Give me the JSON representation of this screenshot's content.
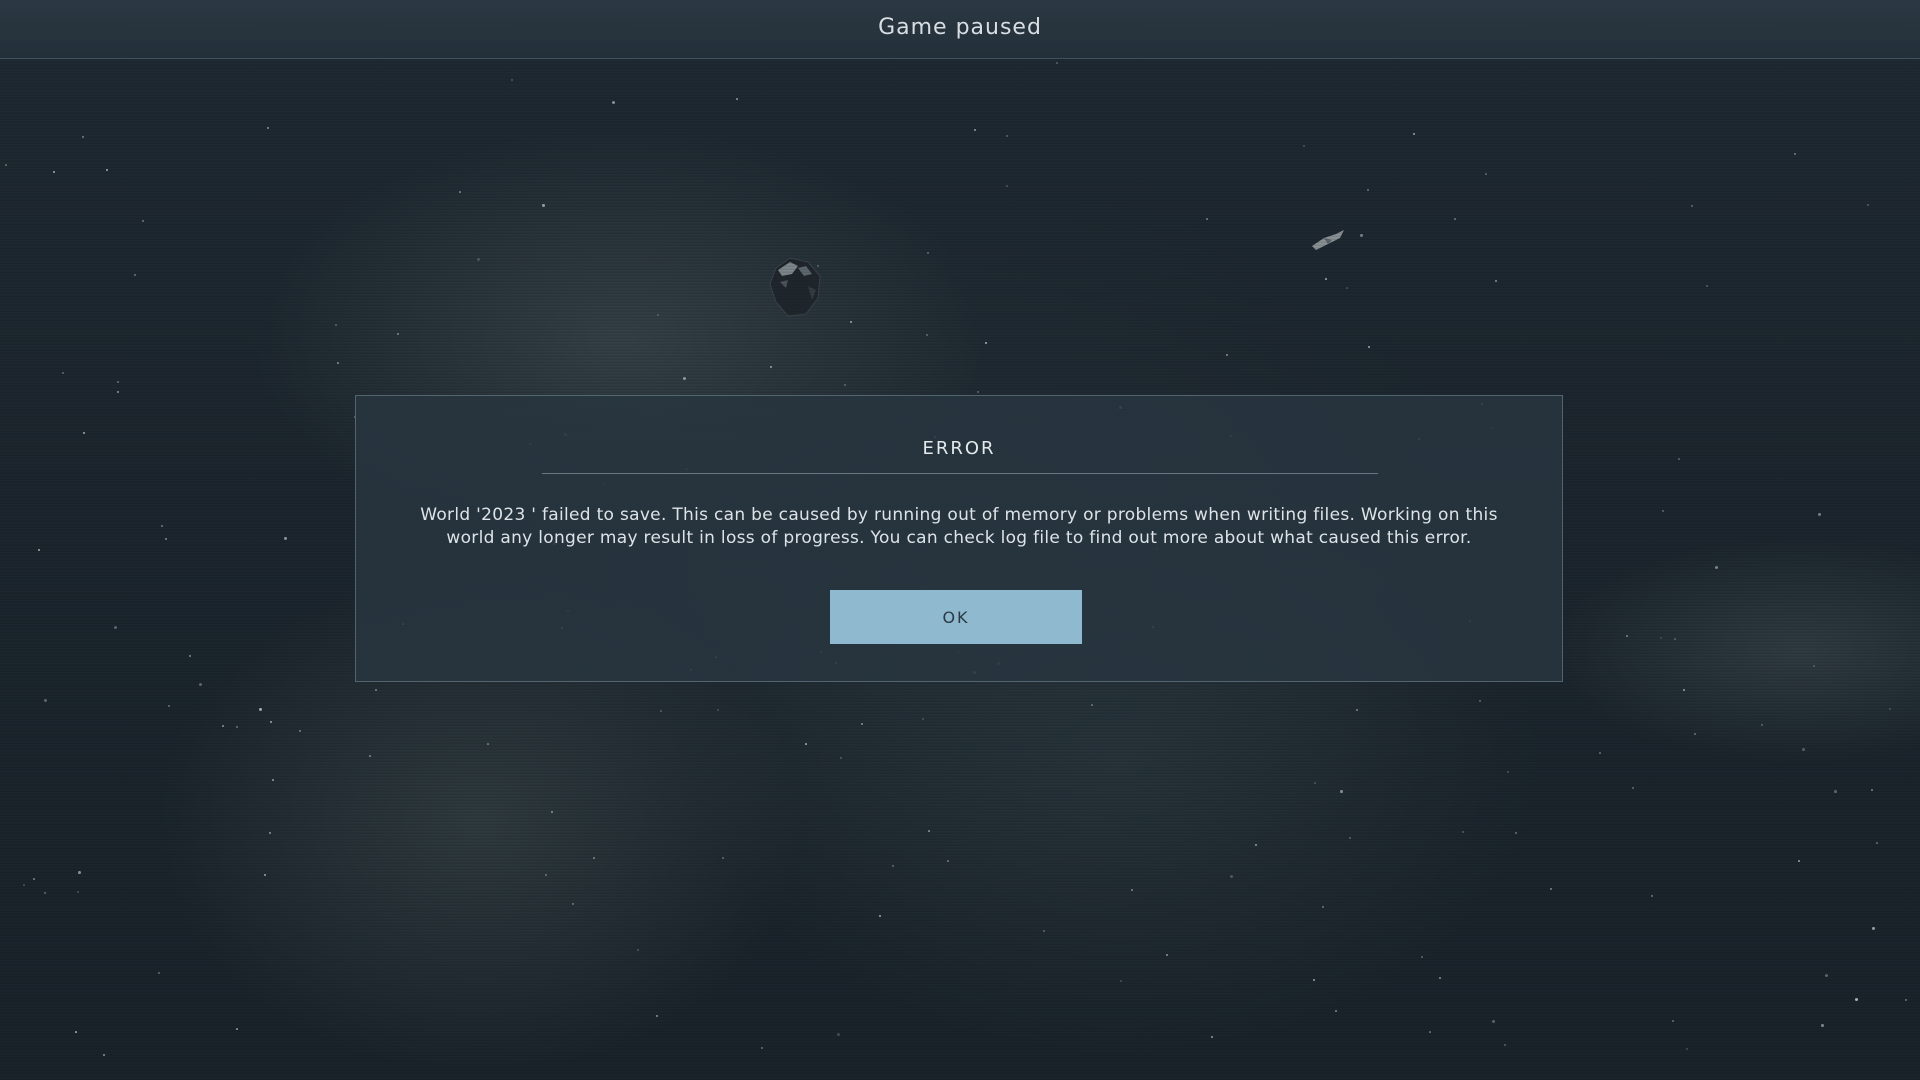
{
  "header": {
    "title": "Game paused"
  },
  "dialog": {
    "title": "ERROR",
    "message": "World '2023 ' failed to save. This can be caused by running out of memory or problems when writing files. Working on this world any longer may result in loss of progress. You can check log file to find out more about what caused this error.",
    "ok_label": "OK"
  },
  "colors": {
    "background": "#1d2830",
    "dialog_background": "#28363f",
    "button_accent": "#8fb9cf",
    "text": "#dde3e7"
  }
}
